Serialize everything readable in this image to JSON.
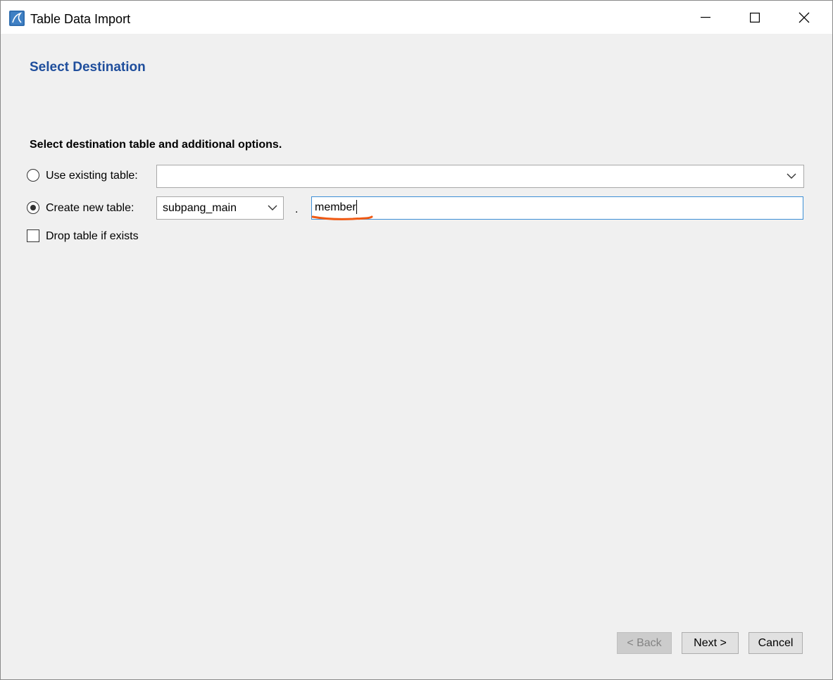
{
  "window": {
    "title": "Table Data Import"
  },
  "page": {
    "heading": "Select Destination",
    "subheading": "Select destination table and additional options."
  },
  "options": {
    "use_existing_label": "Use existing table:",
    "use_existing_value": "",
    "create_new_label": "Create new table:",
    "schema_value": "subpang_main",
    "separator": ".",
    "table_name_value": "member",
    "drop_table_label": "Drop table if exists",
    "selected_option": "create_new",
    "drop_table_checked": false
  },
  "buttons": {
    "back": "< Back",
    "next": "Next >",
    "cancel": "Cancel"
  },
  "colors": {
    "heading": "#1f4e9c",
    "focus_border": "#3c8fd6",
    "annotation": "#f05a14"
  }
}
